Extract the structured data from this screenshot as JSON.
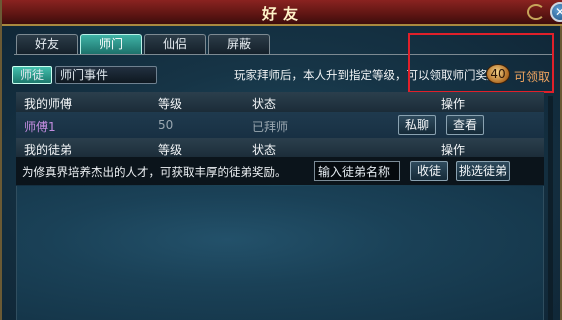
{
  "window": {
    "title": "好友"
  },
  "tabs": [
    {
      "label": "好友",
      "active": false
    },
    {
      "label": "师门",
      "active": true
    },
    {
      "label": "仙侣",
      "active": false
    },
    {
      "label": "屏蔽",
      "active": false
    }
  ],
  "subtabs": [
    {
      "label": "师徒",
      "active": true
    },
    {
      "label": "师门事件",
      "active": false
    }
  ],
  "notice": {
    "text": "玩家拜师后，本人升到指定等级，可以领取师门奖励。",
    "coin_value": "40",
    "claim_label": "可领取"
  },
  "masters_table": {
    "headers": [
      "我的师傅",
      "等级",
      "状态",
      "操作"
    ],
    "rows": [
      {
        "name": "师傅1",
        "level": "50",
        "status": "已拜师",
        "actions": [
          "私聊",
          "查看"
        ]
      }
    ]
  },
  "apprentices_table": {
    "headers": [
      "我的徒弟",
      "等级",
      "状态",
      "操作"
    ],
    "hint": "为修真界培养杰出的人才，可获取丰厚的徒弟奖励。",
    "input_value": "输入徒弟名称",
    "accept_label": "收徒",
    "pick_label": "挑选徒弟"
  },
  "colors": {
    "title_bar": "#8a2320",
    "active_tab": "#3fb3a6",
    "master_name": "#c38de0",
    "claim_text": "#f0a560",
    "highlight_box": "#e0202a"
  }
}
